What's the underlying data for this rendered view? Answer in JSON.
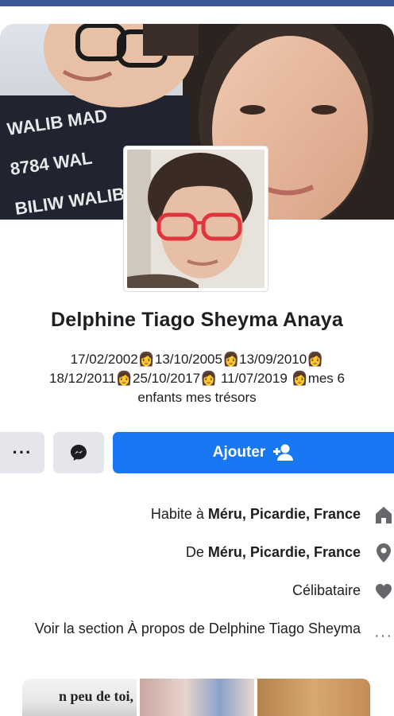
{
  "profile": {
    "name": "Delphine Tiago Sheyma Anaya",
    "bio_line1": "17/02/2002👩13/10/2005👩13/09/2010👩",
    "bio_line2": "18/12/2011👩25/10/2017👩 11/07/2019 👩mes 6",
    "bio_line3": "enfants mes trésors"
  },
  "actions": {
    "add_label": "Ajouter",
    "more_label": "···"
  },
  "info": {
    "lives_prefix": "Habite à ",
    "lives_place": "Méru, Picardie, France",
    "from_prefix": "De ",
    "from_place": "Méru, Picardie, France",
    "relationship": "Célibataire",
    "about_link": "Voir la section À propos de Delphine Tiago Sheyma",
    "about_dots": "···"
  },
  "photos": {
    "first_caption": "n peu de toi,"
  },
  "colors": {
    "brand": "#3b5998",
    "primary_button": "#1877f2",
    "secondary_button": "#e4e6eb",
    "icon_gray": "#65676b"
  },
  "icons": [
    "user-plus-icon",
    "messenger-icon",
    "home-icon",
    "location-pin-icon",
    "heart-icon",
    "more-dots-icon"
  ]
}
